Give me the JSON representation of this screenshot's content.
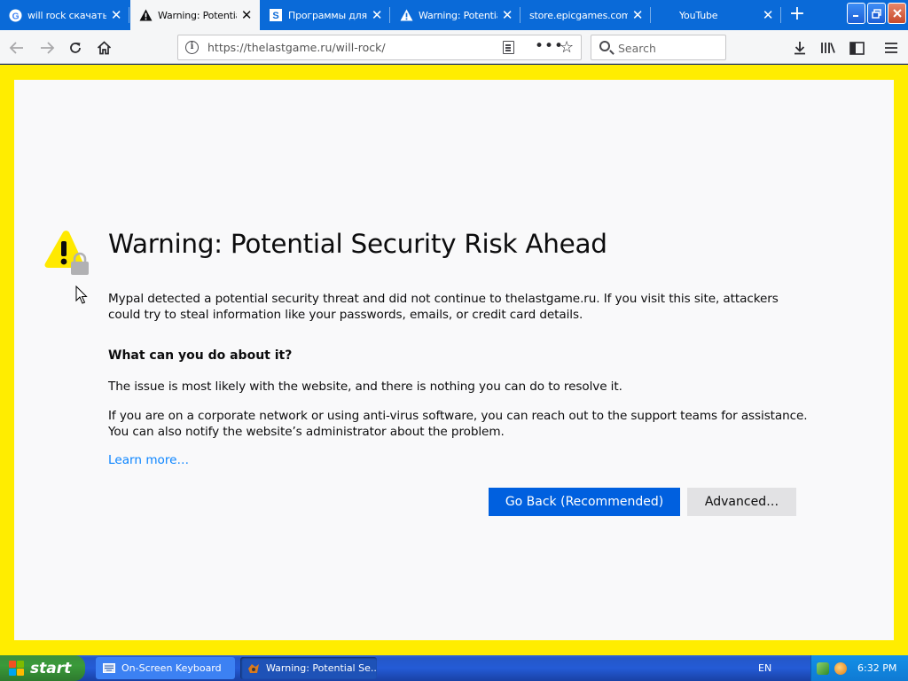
{
  "tabs": [
    {
      "title": "will rock скачать",
      "favicon": "google-icon",
      "active": false
    },
    {
      "title": "Warning: Potential",
      "favicon": "warning-icon",
      "active": true
    },
    {
      "title": "Программы для W",
      "favicon": "site-s-icon",
      "active": false
    },
    {
      "title": "Warning: Potential",
      "favicon": "warning-icon",
      "active": false
    },
    {
      "title": "store.epicgames.com/",
      "favicon": "",
      "active": false
    },
    {
      "title": "YouTube",
      "favicon": "",
      "active": false
    }
  ],
  "navbar": {
    "url": "https://thelastgame.ru/will-rock/",
    "search_placeholder": "Search"
  },
  "page": {
    "title": "Warning: Potential Security Risk Ahead",
    "intro": "Mypal detected a potential security threat and did not continue to thelastgame.ru. If you visit this site, attackers could try to steal information like your passwords, emails, or credit card details.",
    "what_heading": "What can you do about it?",
    "issue_text": "The issue is most likely with the website, and there is nothing you can do to resolve it.",
    "corporate_text": "If you are on a corporate network or using anti-virus software, you can reach out to the support teams for assistance. You can also notify the website’s administrator about the problem.",
    "learn_more": "Learn more…",
    "go_back_label": "Go Back (Recommended)",
    "advanced_label": "Advanced…"
  },
  "colors": {
    "tabstrip": "#0a6ad8",
    "frame_yellow": "#ffed00",
    "primary_button": "#0060df",
    "link": "#0a84ff",
    "warning_yellow": "#ffe900"
  },
  "taskbar": {
    "start_label": "start",
    "tasks": [
      {
        "label": "On-Screen Keyboard",
        "icon": "keyboard-icon"
      },
      {
        "label": "Warning: Potential Se...",
        "icon": "mypal-icon"
      }
    ],
    "language": "EN",
    "time": "6:32 PM"
  }
}
